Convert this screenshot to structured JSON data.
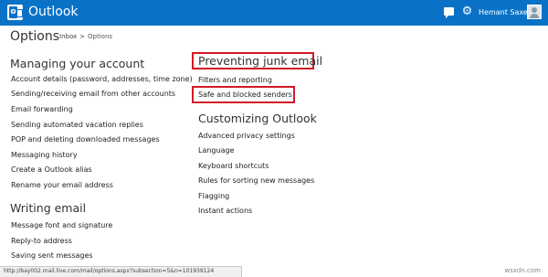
{
  "app": {
    "brand": "Outlook",
    "user_name": "Hemant Saxena"
  },
  "header": {
    "icons": [
      "chat-icon",
      "gear-icon"
    ]
  },
  "page": {
    "title": "Options",
    "breadcrumb": {
      "root": "Inbox",
      "separator": ">",
      "current": "Options"
    }
  },
  "left": {
    "managing": {
      "heading": "Managing your account",
      "items": [
        "Account details (password, addresses, time zone)",
        "Sending/receiving email from other accounts",
        "Email forwarding",
        "Sending automated vacation replies",
        "POP and deleting downloaded messages",
        "Messaging history",
        "Create a Outlook alias",
        "Rename your email address"
      ]
    },
    "writing": {
      "heading": "Writing email",
      "items": [
        "Message font and signature",
        "Reply-to address",
        "Saving sent messages"
      ]
    }
  },
  "right": {
    "junk": {
      "heading": "Preventing junk email",
      "items": [
        "Filters and reporting",
        "Safe and blocked senders"
      ]
    },
    "customizing": {
      "heading": "Customizing Outlook",
      "items": [
        "Advanced privacy settings",
        "Language",
        "Keyboard shortcuts",
        "Rules for sorting new messages",
        "Flagging",
        "Instant actions"
      ]
    }
  },
  "status_url": "http://bay002.mail.live.com/mail/options.aspx?subsection=5&n=101939124",
  "watermark": "wsxdn.com",
  "colors": {
    "topbar": "#0a72c6",
    "highlight": "#d21a26"
  }
}
